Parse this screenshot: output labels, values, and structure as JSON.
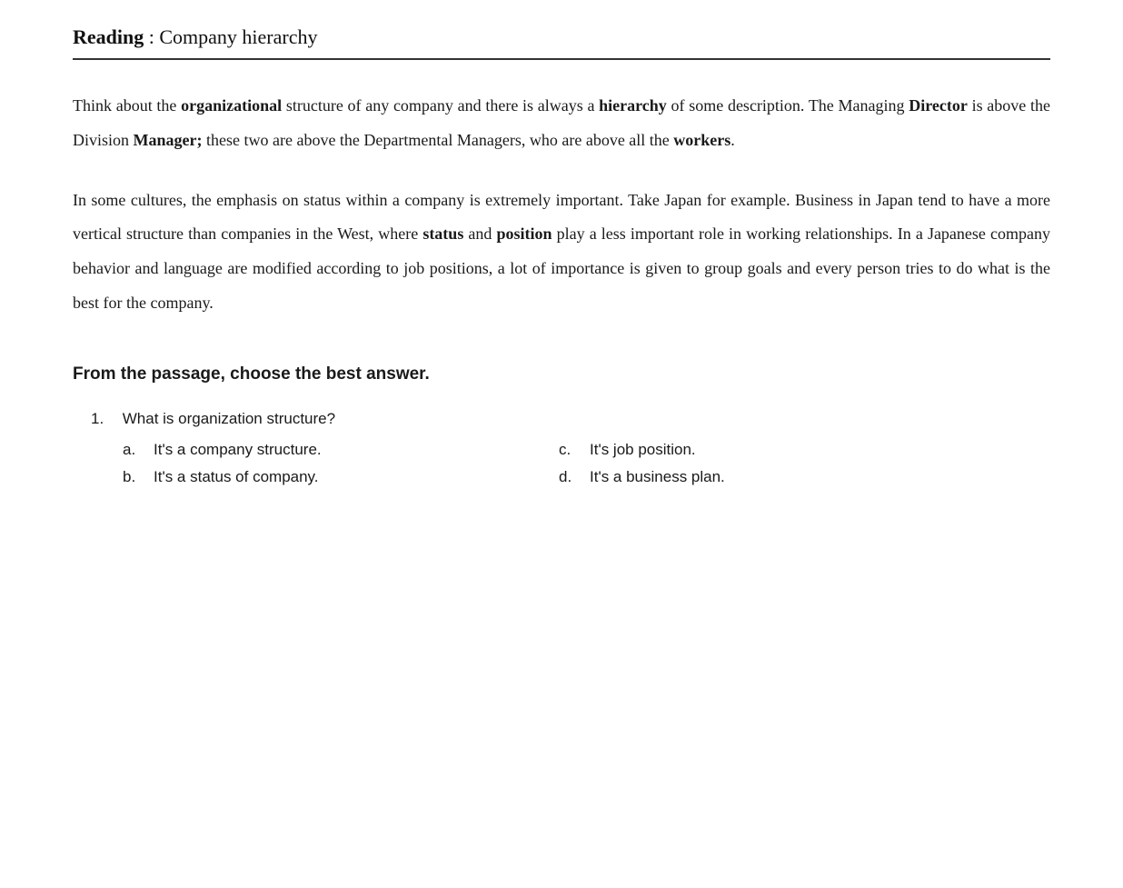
{
  "header": {
    "label_bold": "Reading",
    "label_rest": " : Company hierarchy"
  },
  "passage": {
    "paragraph1": {
      "parts": [
        {
          "text": "Think about the ",
          "bold": false
        },
        {
          "text": "organizational",
          "bold": true
        },
        {
          "text": " structure of any company and there is always a ",
          "bold": false
        },
        {
          "text": "hierarchy",
          "bold": true
        },
        {
          "text": " of some description. The Managing ",
          "bold": false
        },
        {
          "text": "Director",
          "bold": true
        },
        {
          "text": " is above the Division ",
          "bold": false
        },
        {
          "text": "Manager;",
          "bold": true
        },
        {
          "text": " these two are above the Departmental Managers, who are above all the ",
          "bold": false
        },
        {
          "text": "workers",
          "bold": true
        },
        {
          "text": ".",
          "bold": false
        }
      ]
    },
    "paragraph2": {
      "parts": [
        {
          "text": "In some cultures, the emphasis on status within a company is extremely important. Take Japan for example. Business in Japan tend to have a more vertical structure than companies in the West, where ",
          "bold": false
        },
        {
          "text": "status",
          "bold": true
        },
        {
          "text": " and ",
          "bold": false
        },
        {
          "text": "position",
          "bold": true
        },
        {
          "text": " play a less important role in working relationships. In a Japanese company behavior and language are modified according to job positions, a lot of importance is given to group goals and every person tries to do what is the best for the company.",
          "bold": false
        }
      ]
    }
  },
  "questions": {
    "instruction": "From the passage, choose the best answer.",
    "items": [
      {
        "number": "1.",
        "text": "What is organization structure?",
        "answers": [
          {
            "letter": "a.",
            "text": "It's a company structure."
          },
          {
            "letter": "c.",
            "text": "It's job position."
          },
          {
            "letter": "b.",
            "text": "It's a status of company."
          },
          {
            "letter": "d.",
            "text": "It's a business plan."
          }
        ]
      }
    ]
  }
}
